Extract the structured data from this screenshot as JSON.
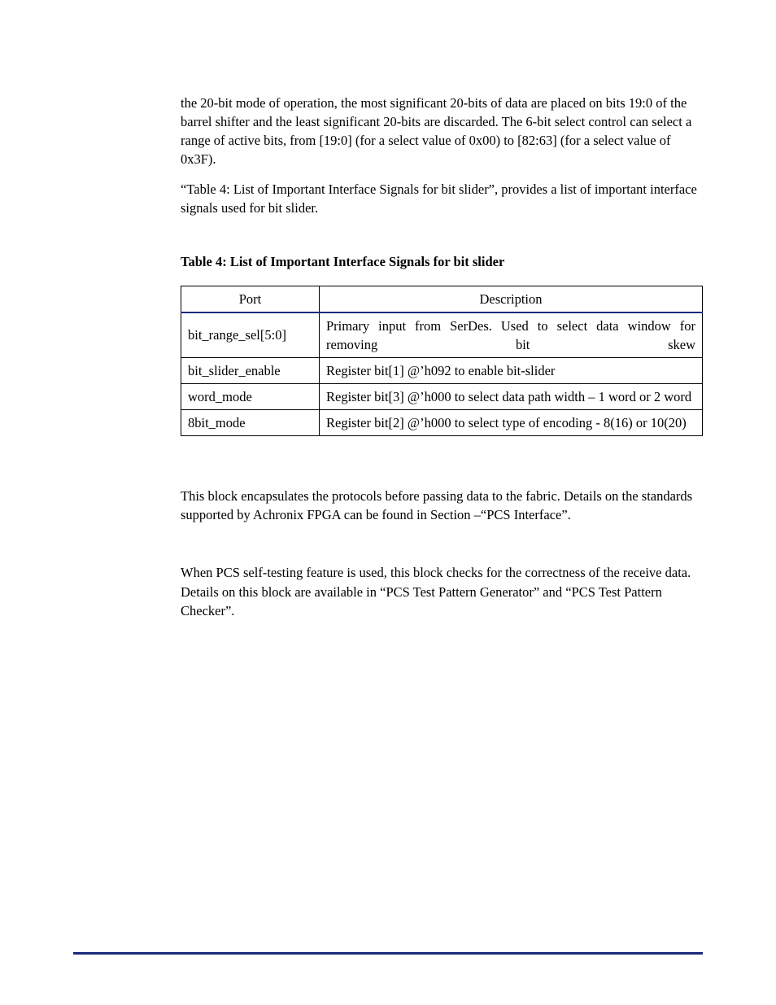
{
  "paragraphs": {
    "intro": "the 20-bit mode of operation, the most significant 20-bits of data are placed on bits 19:0 of the barrel shifter and the least significant 20-bits are discarded. The 6-bit select control can select a range of active bits, from [19:0] (for a select value of 0x00) to [82:63] (for a select value of 0x3F).",
    "ref": "“Table 4: List of Important Interface Signals for bit slider”, provides a list of important interface signals used for bit slider.",
    "encaps": "This block encapsulates the protocols before passing data to the fabric. Details on the standards supported by Achronix FPGA can be found in Section –“PCS Interface”.",
    "selftest": "When PCS self-testing feature is used, this block checks for the correctness of the receive data. Details on this block are available in “PCS Test Pattern Generator” and “PCS Test Pattern Checker”."
  },
  "table": {
    "caption": "Table 4: List of Important Interface Signals for bit slider",
    "headers": {
      "port": "Port",
      "description": "Description"
    },
    "rows": [
      {
        "port": "bit_range_sel[5:0]",
        "description": "Primary input from SerDes.  Used to select data window for removing bit skew"
      },
      {
        "port": "bit_slider_enable",
        "description": "Register bit[1] @’h092 to enable bit-slider"
      },
      {
        "port": "word_mode",
        "description": "Register bit[3] @’h000 to select data path width – 1 word or 2 word"
      },
      {
        "port": "8bit_mode",
        "description": "Register bit[2] @’h000 to select type of encoding - 8(16) or 10(20)"
      }
    ]
  }
}
